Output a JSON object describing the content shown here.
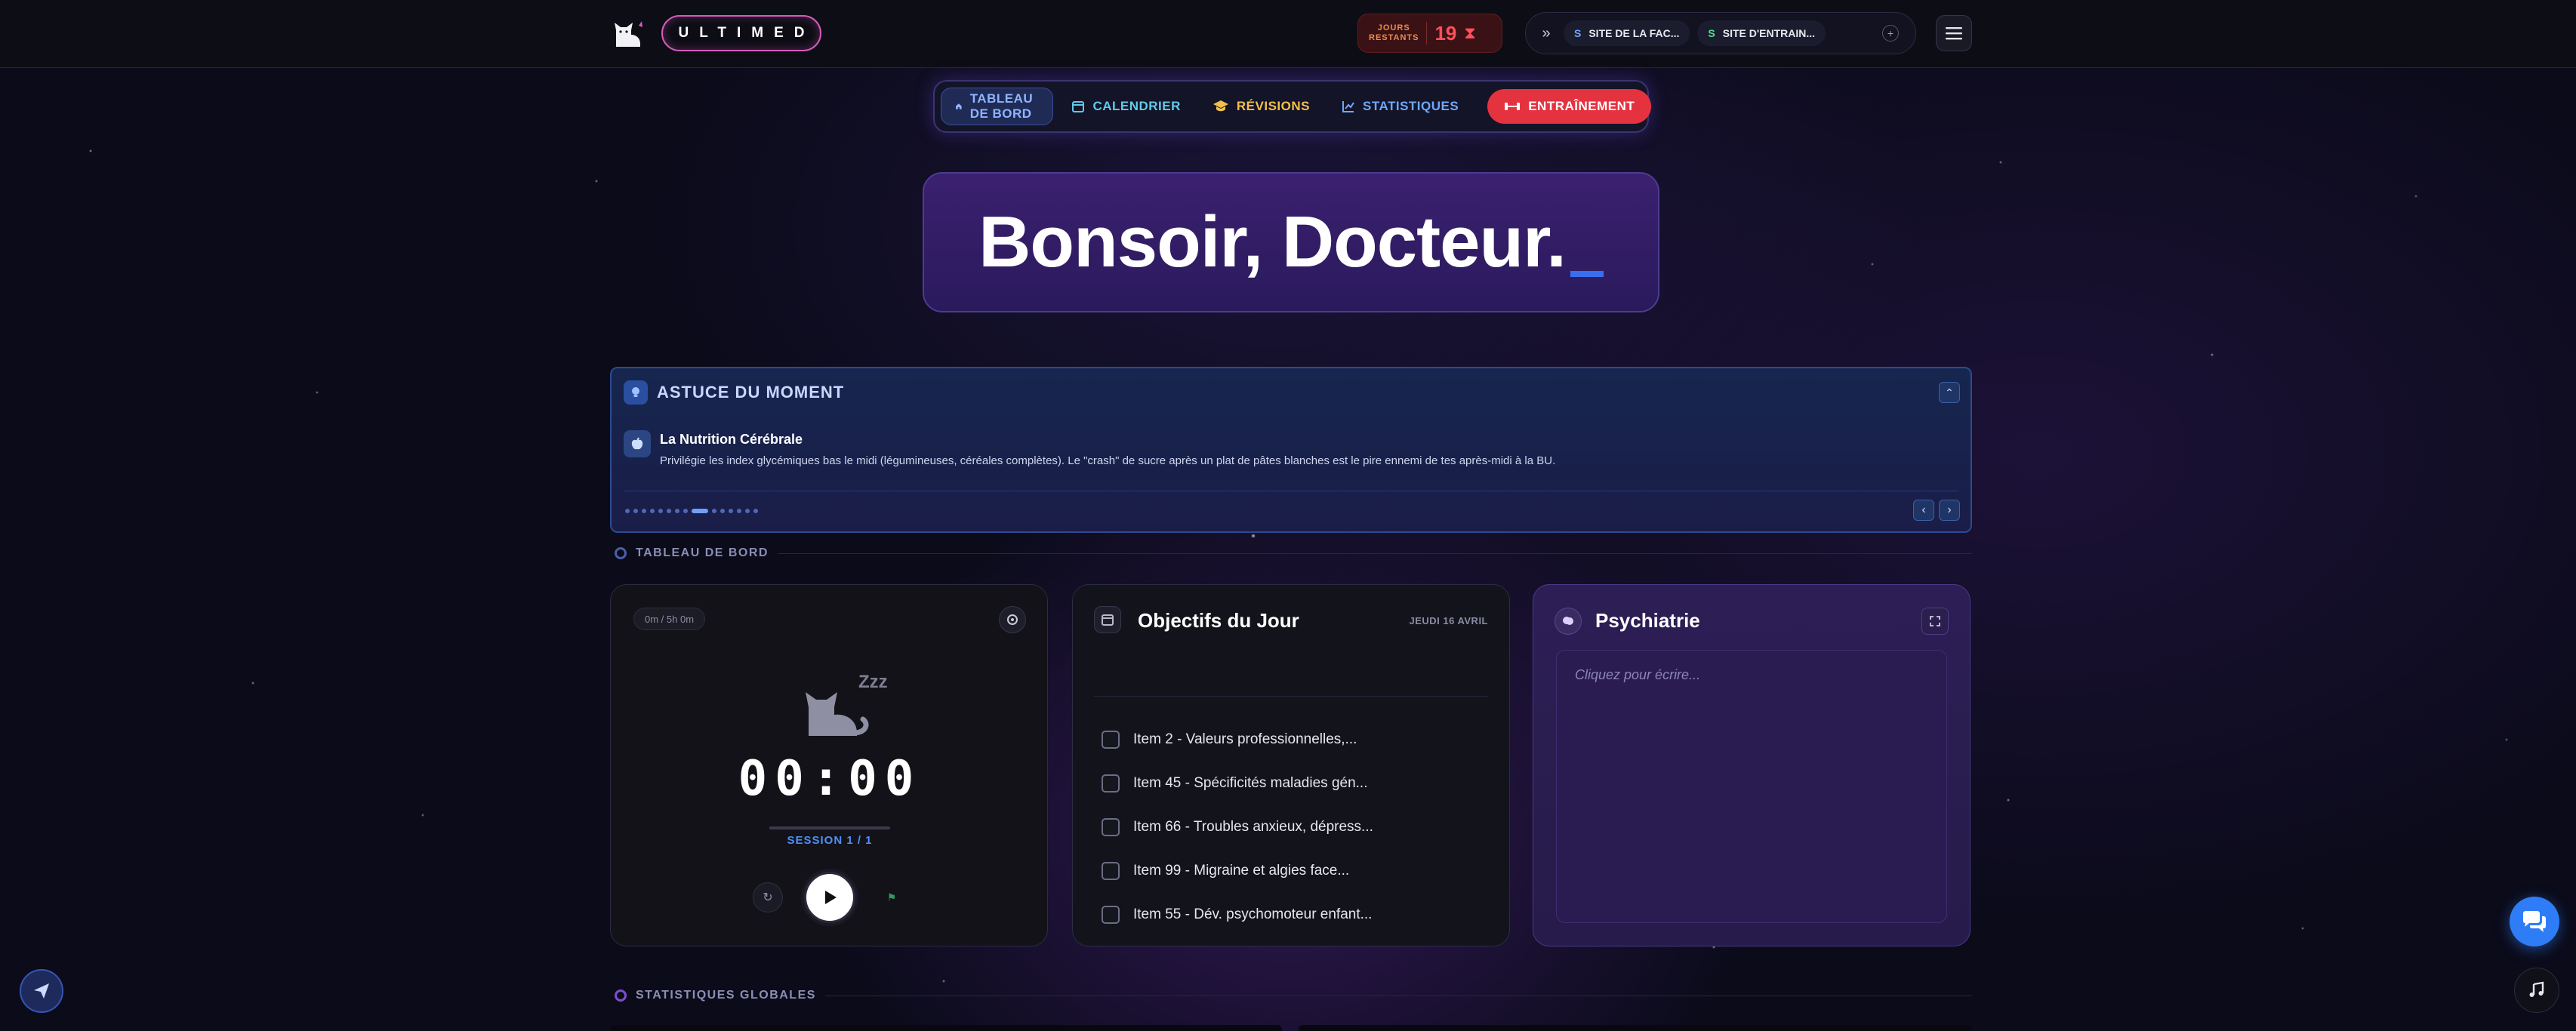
{
  "header": {
    "brand": "ULTIMED",
    "days_label_top": "JOURS",
    "days_label_bottom": "RESTANTS",
    "days_value": "19",
    "sites": [
      {
        "badge": "S",
        "label": "SITE DE LA FAC..."
      },
      {
        "badge": "S",
        "label": "SITE D'ENTRAIN..."
      }
    ]
  },
  "nav": {
    "dashboard": "TABLEAU DE BORD",
    "calendar": "CALENDRIER",
    "revisions": "RÉVISIONS",
    "stats": "STATISTIQUES",
    "training": "ENTRAÎNEMENT"
  },
  "greeting": {
    "text": "Bonsoir, Docteur."
  },
  "tip": {
    "title": "ASTUCE DU MOMENT",
    "subtitle": "La Nutrition Cérébrale",
    "description": "Privilégie les index glycémiques bas le midi (légumineuses, céréales complètes). Le \"crash\" de sucre après un plat de pâtes blanches est le pire ennemi de tes après-midi à la BU.",
    "dots_total": 15,
    "dots_active": 8
  },
  "sections": {
    "dashboard": "TABLEAU DE BORD",
    "global_stats": "STATISTIQUES GLOBALES"
  },
  "timer": {
    "progress": "0m / 5h 0m",
    "zzz": "Zzz",
    "clock": "00:00",
    "session": "SESSION 1 / 1"
  },
  "objectives": {
    "title": "Objectifs du Jour",
    "date": "JEUDI 16 AVRIL",
    "items": [
      "Item 2 - Valeurs professionnelles,...",
      "Item 45 - Spécificités maladies gén...",
      "Item 66 - Troubles anxieux, dépress...",
      "Item 99 - Migraine et algies face...",
      "Item 55 - Dév. psychomoteur enfant..."
    ]
  },
  "notes": {
    "title": "Psychiatrie",
    "placeholder": "Cliquez pour écrire..."
  },
  "colors": {
    "accent": "#e5323f",
    "primary": "#4f8ff7",
    "brand_border": "#d65bbd"
  }
}
